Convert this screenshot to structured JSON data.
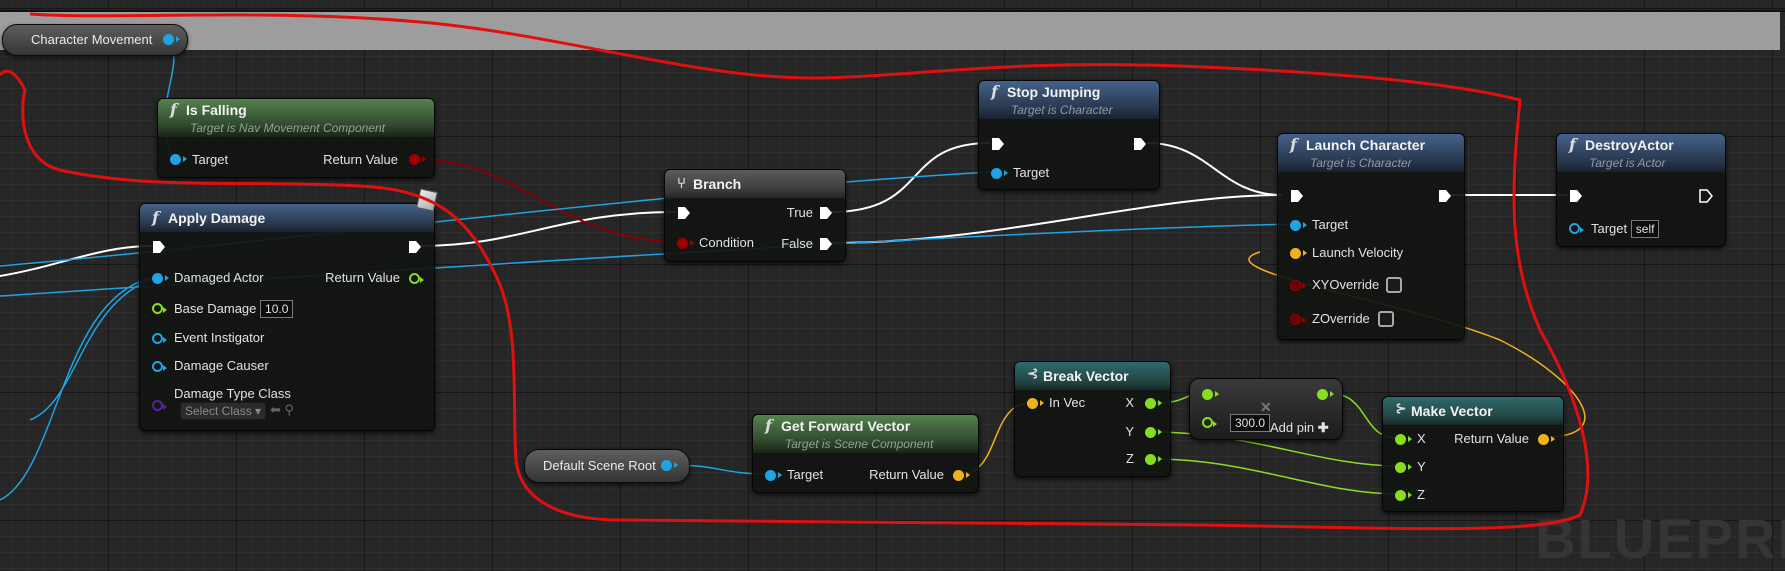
{
  "comment": {
    "label": "Character Movement"
  },
  "nodes": {
    "is_falling": {
      "title": "Is Falling",
      "subtitle": "Target is Nav Movement Component",
      "target": "Target",
      "return_value": "Return Value"
    },
    "apply_damage": {
      "title": "Apply Damage",
      "damaged_actor": "Damaged Actor",
      "return_value": "Return Value",
      "base_damage": "Base Damage",
      "base_damage_value": "10.0",
      "event_instigator": "Event Instigator",
      "damage_causer": "Damage Causer",
      "damage_type_class": "Damage Type Class",
      "select_class": "Select Class ▾"
    },
    "branch": {
      "title": "Branch",
      "true_label": "True",
      "condition": "Condition",
      "false_label": "False"
    },
    "stop_jumping": {
      "title": "Stop Jumping",
      "subtitle": "Target is Character",
      "target": "Target"
    },
    "launch_character": {
      "title": "Launch Character",
      "subtitle": "Target is Character",
      "target": "Target",
      "launch_velocity": "Launch Velocity",
      "xy_override": "XYOverride",
      "z_override": "ZOverride"
    },
    "destroy_actor": {
      "title": "DestroyActor",
      "subtitle": "Target is Actor",
      "target": "Target",
      "self_value": "self"
    },
    "default_scene_root": {
      "label": "Default Scene Root"
    },
    "get_forward_vector": {
      "title": "Get Forward Vector",
      "subtitle": "Target is Scene Component",
      "target": "Target",
      "return_value": "Return Value"
    },
    "break_vector": {
      "title": "Break Vector",
      "in_vec": "In Vec",
      "x": "X",
      "y": "Y",
      "z": "Z"
    },
    "multiply": {
      "value": "300.0",
      "add_pin": "Add pin",
      "add_icon": "✚",
      "op_glyph": "✕"
    },
    "make_vector": {
      "title": "Make Vector",
      "x": "X",
      "y": "Y",
      "z": "Z",
      "return_value": "Return Value"
    }
  },
  "watermark": "BLUEPRI",
  "colors": {
    "exec": "#ffffff",
    "object_pin": "#1fa3e3",
    "bool_pin": "#9c0000",
    "float_pin": "#88dd22",
    "vector_pin": "#f0b21c",
    "annotation": "#e01010"
  }
}
